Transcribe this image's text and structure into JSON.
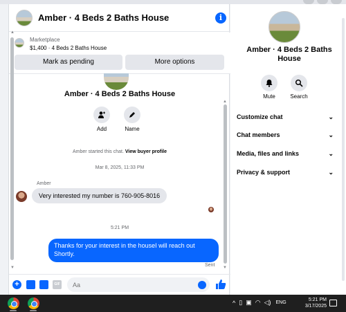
{
  "header": {
    "title": "Amber · 4 Beds 2 Baths House",
    "info_icon": "info-icon"
  },
  "marketplace": {
    "label": "Marketplace",
    "price_title": "$1,400 · 4 Beds 2 Baths House",
    "pending_button": "Mark as pending",
    "options_button": "More options"
  },
  "conversation": {
    "title": "Amber · 4 Beds 2 Baths House",
    "actions": [
      {
        "label": "Add",
        "icon": "add-person-icon"
      },
      {
        "label": "Name",
        "icon": "pencil-icon"
      }
    ],
    "started_prefix": "Amber started this chat.",
    "started_link": "View buyer profile",
    "timestamp1": "Mar 8, 2025, 11:33 PM",
    "sender": "Amber",
    "incoming_message": "Very interested my number is 760-905-8016",
    "timestamp2": "5:21 PM",
    "outgoing_message": "Thanks for your interest in the houseI will reach out Shortly.",
    "sent_status": "Sent"
  },
  "composer": {
    "placeholder": "Aa",
    "gif_label": "GIF"
  },
  "right_panel": {
    "title": "Amber · 4 Beds 2 Baths House",
    "actions": [
      {
        "label": "Mute",
        "icon": "bell-icon"
      },
      {
        "label": "Search",
        "icon": "search-icon"
      }
    ],
    "sections": [
      "Customize chat",
      "Chat members",
      "Media, files and links",
      "Privacy & support"
    ]
  },
  "taskbar": {
    "language": "ENG",
    "time": "5:21 PM",
    "date": "3/17/2025"
  },
  "colors": {
    "accent": "#0866ff",
    "bubble_in": "#e4e6eb",
    "taskbar": "#1f1f1f"
  }
}
